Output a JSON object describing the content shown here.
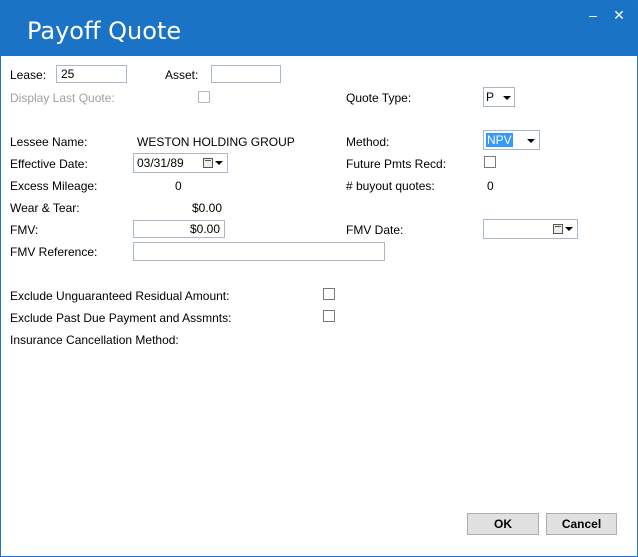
{
  "window": {
    "title": "Payoff Quote",
    "minimize_glyph": "–",
    "close_glyph": "✕"
  },
  "form": {
    "lease_label": "Lease:",
    "lease_value": "25",
    "asset_label": "Asset:",
    "asset_value": "",
    "display_last_quote_label": "Display Last Quote:",
    "quote_type_label": "Quote Type:",
    "quote_type_value": "P",
    "lessee_name_label": "Lessee Name:",
    "lessee_name_value": "WESTON HOLDING GROUP",
    "method_label": "Method:",
    "method_value": "NPV",
    "effective_date_label": "Effective Date:",
    "effective_date_value": "03/31/89",
    "future_pmts_label": "Future Pmts Recd:",
    "excess_mileage_label": "Excess Mileage:",
    "excess_mileage_value": "0",
    "buyout_quotes_label": "# buyout quotes:",
    "buyout_quotes_value": "0",
    "wear_tear_label": "Wear & Tear:",
    "wear_tear_value": "$0.00",
    "fmv_label": "FMV:",
    "fmv_value": "$0.00",
    "fmv_date_label": "FMV Date:",
    "fmv_date_value": "",
    "fmv_reference_label": "FMV Reference:",
    "fmv_reference_value": "",
    "exclude_residual_label": "Exclude Unguaranteed Residual Amount:",
    "exclude_past_due_label": "Exclude Past Due Payment and Assmnts:",
    "insurance_label": "Insurance Cancellation Method:"
  },
  "buttons": {
    "ok": "OK",
    "cancel": "Cancel"
  },
  "icons": {
    "calendar": "calendar-icon",
    "dropdown": "chevron-down-icon"
  },
  "colors": {
    "titlebar": "#1a73c4",
    "selection": "#3399ff"
  }
}
